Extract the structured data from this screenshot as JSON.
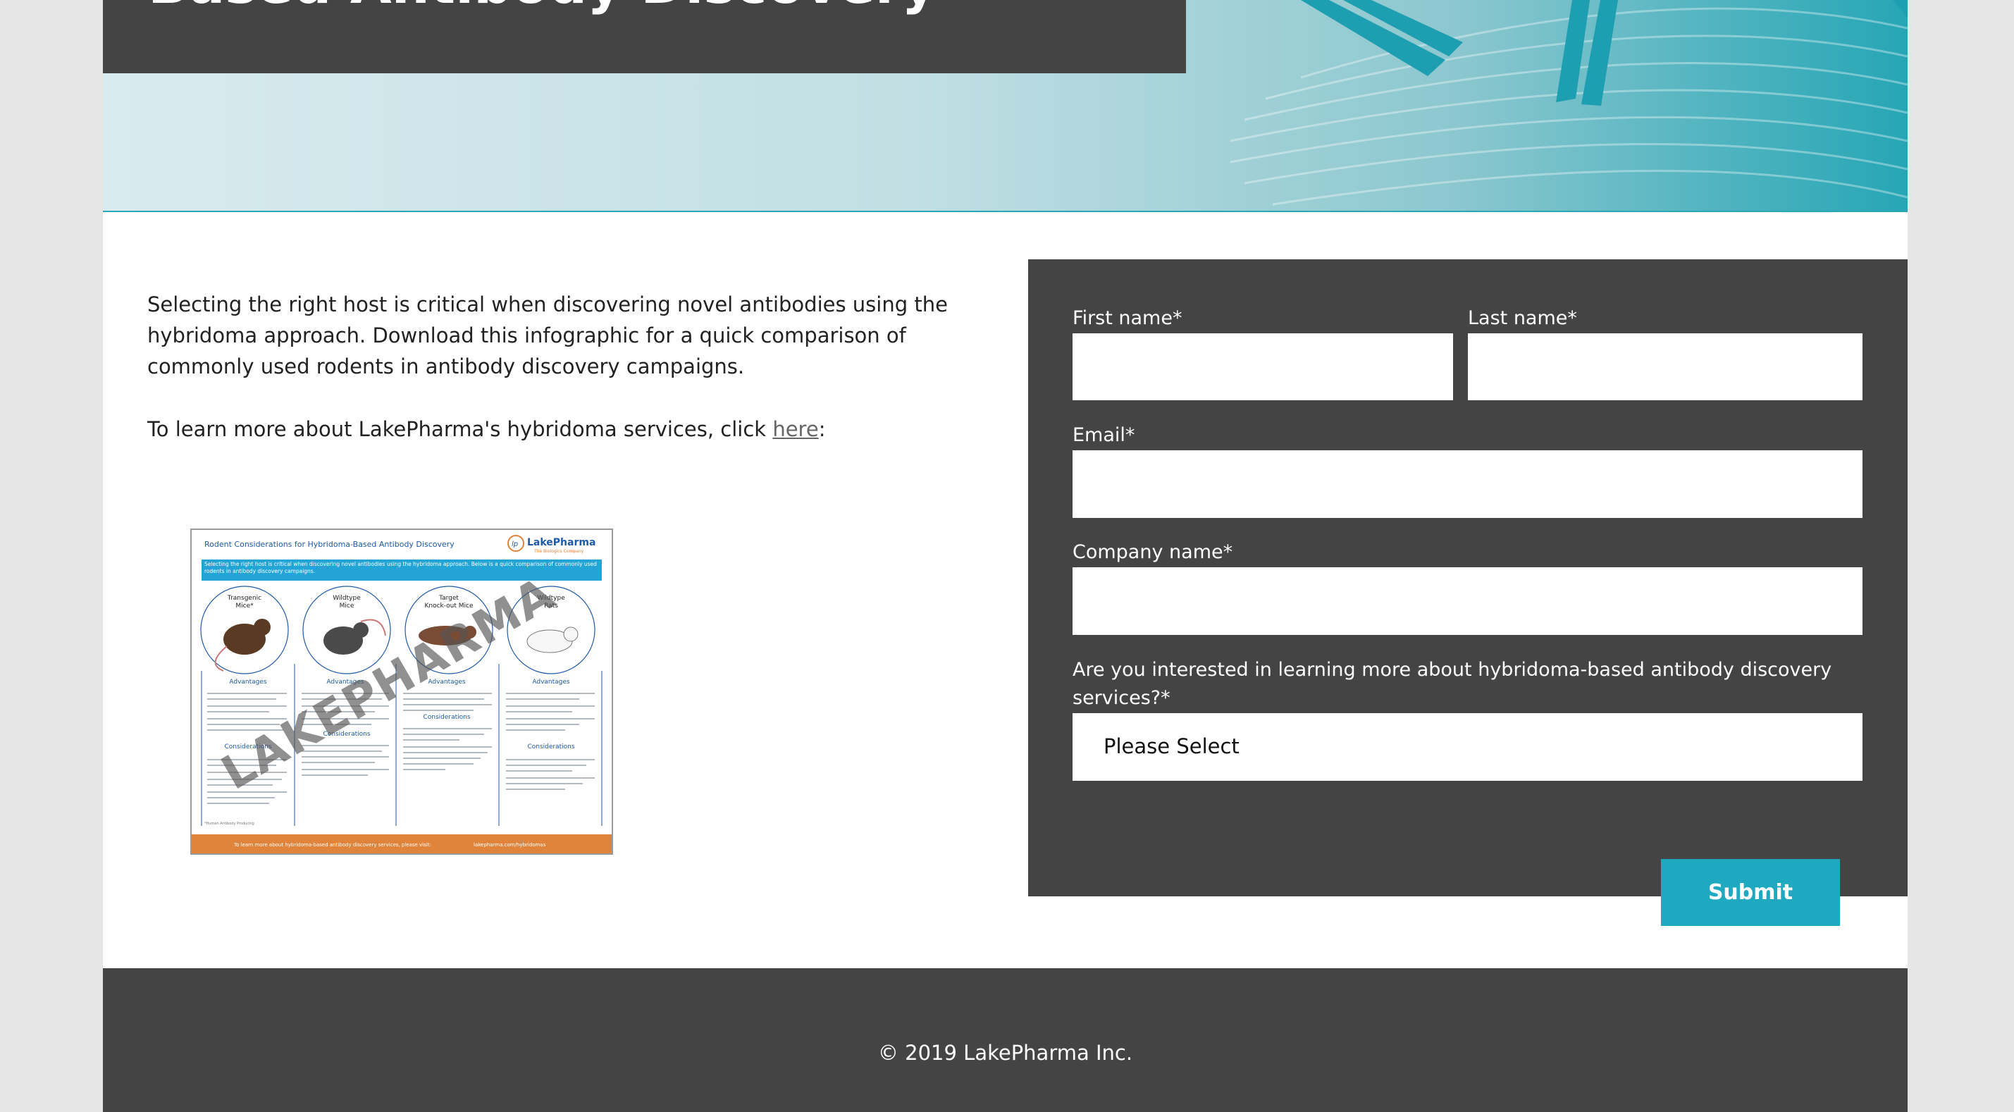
{
  "hero": {
    "title": "Based Antibody Discovery"
  },
  "content": {
    "intro": "Selecting the right host is critical when discovering novel antibodies using the hybridoma approach. Download this infographic for a quick comparison of commonly used rodents in antibody discovery campaigns.",
    "learn_prefix": "To learn more about LakePharma's hybridoma services, click ",
    "learn_link": "here",
    "learn_suffix": ":"
  },
  "infographic": {
    "title": "Rodent Considerations for Hybridoma-Based Antibody Discovery",
    "brand": "LakePharma",
    "brand_tagline": "The Biologics Company",
    "banner": "Selecting the right host is critical when discovering novel antibodies using the hybridoma approach. Below is a quick comparison of commonly used rodents in antibody discovery campaigns.",
    "columns": [
      {
        "name_line1": "Transgenic",
        "name_line2": "Mice*"
      },
      {
        "name_line1": "Wildtype",
        "name_line2": "Mice"
      },
      {
        "name_line1": "Target",
        "name_line2": "Knock-out Mice"
      },
      {
        "name_line1": "Wildtype",
        "name_line2": "Rats"
      }
    ],
    "advantages_label": "Advantages",
    "considerations_label": "Considerations",
    "footnote": "*Human Antibody Producing",
    "footer": "To learn more about hybridoma-based antibody discovery services, please visit:",
    "footer_url": "lakepharma.com/hybridomas",
    "watermark": "LAKEPHARMA",
    "colors": {
      "accent": "#1e5aa8",
      "banner": "#23a4d6",
      "footer": "#e0843c"
    }
  },
  "form": {
    "first_name_label": "First name*",
    "last_name_label": "Last name*",
    "email_label": "Email*",
    "company_label": "Company name*",
    "interest_label": "Are you interested in learning more about hybridoma-based antibody discovery services?*",
    "select_value": "Please Select",
    "submit_label": "Submit"
  },
  "footer": {
    "copyright": "© 2019 LakePharma Inc."
  },
  "colors": {
    "dark_panel": "#444444",
    "accent": "#1fa9c1",
    "page_bg": "#e6e6e6"
  }
}
